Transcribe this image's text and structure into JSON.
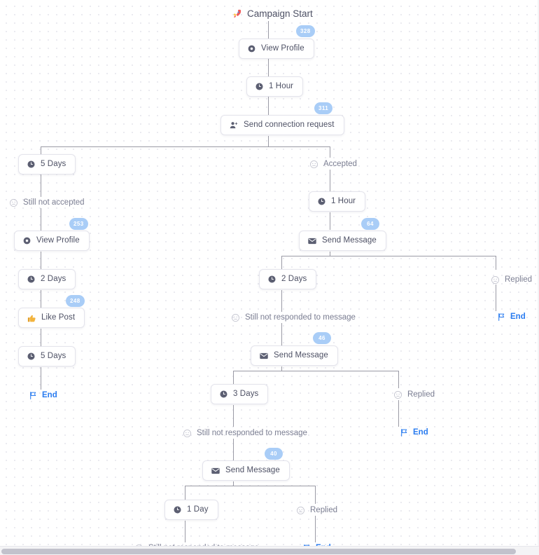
{
  "header": {
    "title": "Campaign Start",
    "icon": "rocket-icon"
  },
  "colors": {
    "badge_bg": "#a9cdf7",
    "end_accent": "#2a7cf0",
    "node_text": "#4d5064",
    "label_text": "#7b7e92",
    "line": "#9a9aa5"
  },
  "nodes": {
    "view_profile_1": {
      "label": "View Profile",
      "icon": "eye-icon",
      "badge": "328"
    },
    "delay_1hour_1": {
      "label": "1 Hour",
      "icon": "clock-icon"
    },
    "send_connection_request": {
      "label": "Send connection request",
      "icon": "person-add-icon",
      "badge": "311"
    },
    "delay_5days_left": {
      "label": "5 Days",
      "icon": "clock-icon"
    },
    "still_not_accepted": {
      "label": "Still not accepted",
      "icon": "neutral-face-icon"
    },
    "view_profile_2": {
      "label": "View Profile",
      "icon": "eye-icon",
      "badge": "253"
    },
    "delay_2days_left": {
      "label": "2 Days",
      "icon": "clock-icon"
    },
    "like_post": {
      "label": "Like Post",
      "icon": "thumbs-up-icon",
      "badge": "248"
    },
    "delay_5days_left_2": {
      "label": "5 Days",
      "icon": "clock-icon"
    },
    "end_left": {
      "label": "End",
      "icon": "flag-icon"
    },
    "accepted": {
      "label": "Accepted",
      "icon": "neutral-face-icon"
    },
    "delay_1hour_2": {
      "label": "1 Hour",
      "icon": "clock-icon"
    },
    "send_message_1": {
      "label": "Send Message",
      "icon": "envelope-icon",
      "badge": "64"
    },
    "delay_2days_mid": {
      "label": "2 Days",
      "icon": "clock-icon"
    },
    "replied_1": {
      "label": "Replied",
      "icon": "neutral-face-icon"
    },
    "end_replied_1": {
      "label": "End",
      "icon": "flag-icon"
    },
    "still_not_responded_1": {
      "label": "Still not responded to message",
      "icon": "neutral-face-icon"
    },
    "send_message_2": {
      "label": "Send Message",
      "icon": "envelope-icon",
      "badge": "46"
    },
    "delay_3days": {
      "label": "3 Days",
      "icon": "clock-icon"
    },
    "replied_2": {
      "label": "Replied",
      "icon": "neutral-face-icon"
    },
    "end_replied_2": {
      "label": "End",
      "icon": "flag-icon"
    },
    "still_not_responded_2": {
      "label": "Still not responded to message",
      "icon": "neutral-face-icon"
    },
    "send_message_3": {
      "label": "Send Message",
      "icon": "envelope-icon",
      "badge": "40"
    },
    "delay_1day": {
      "label": "1 Day",
      "icon": "clock-icon"
    },
    "replied_3": {
      "label": "Replied",
      "icon": "neutral-face-icon"
    },
    "end_replied_3": {
      "label": "End",
      "icon": "flag-icon"
    },
    "still_not_responded_3": {
      "label": "Still not responded to message",
      "icon": "neutral-face-icon"
    }
  }
}
